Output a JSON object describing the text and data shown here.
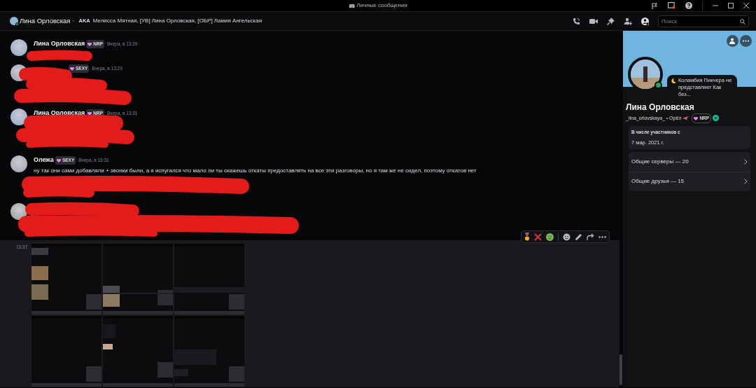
{
  "titlebar": {
    "title": "Личные сообщения"
  },
  "header": {
    "name": "Лина Орловская",
    "aka_label": "AKA",
    "aka": "Мелисса Мятная, [УВ] Лина Орловская, [ОБР] Ламия Ангельская",
    "search": {
      "placeholder": "Поиск"
    }
  },
  "messages": [
    {
      "author": "Лина Орловская",
      "badge": "NRP",
      "time": "Вчера, в 13:29",
      "redacted": true
    },
    {
      "badge": "SEXY",
      "time": "Вчера, в 13:29",
      "redacted": true
    },
    {
      "author": "Лина Орловская",
      "badge": "NRP",
      "time": "Вчера, в 13:31",
      "redacted": true
    },
    {
      "author": "Олежа",
      "badge": "SEXY",
      "time": "Вчера, в 13:31",
      "text": "ну так они сами добавляли + звонки были, а я испугался что мало ли ты скажешь откаты предоставлять на все эти разговоры, но я там же не сидел, поэтому откатов нет",
      "redacted": true
    },
    {
      "redacted": true
    }
  ],
  "attachment_message": {
    "time": "13:37",
    "hovered": true
  },
  "profile": {
    "status": "Коламбия Пикчера не представляет Как без...",
    "online": true,
    "name": "Лина Орловская",
    "username": "_lina_orlovskaya_",
    "pronoun": "Орёл",
    "badge": "NRP",
    "member_since_label": "В числе участников с",
    "member_since": "7 мар. 2021 г.",
    "links": [
      {
        "label": "Общие серверы — 20"
      },
      {
        "label": "Общие друзья — 15"
      }
    ]
  }
}
